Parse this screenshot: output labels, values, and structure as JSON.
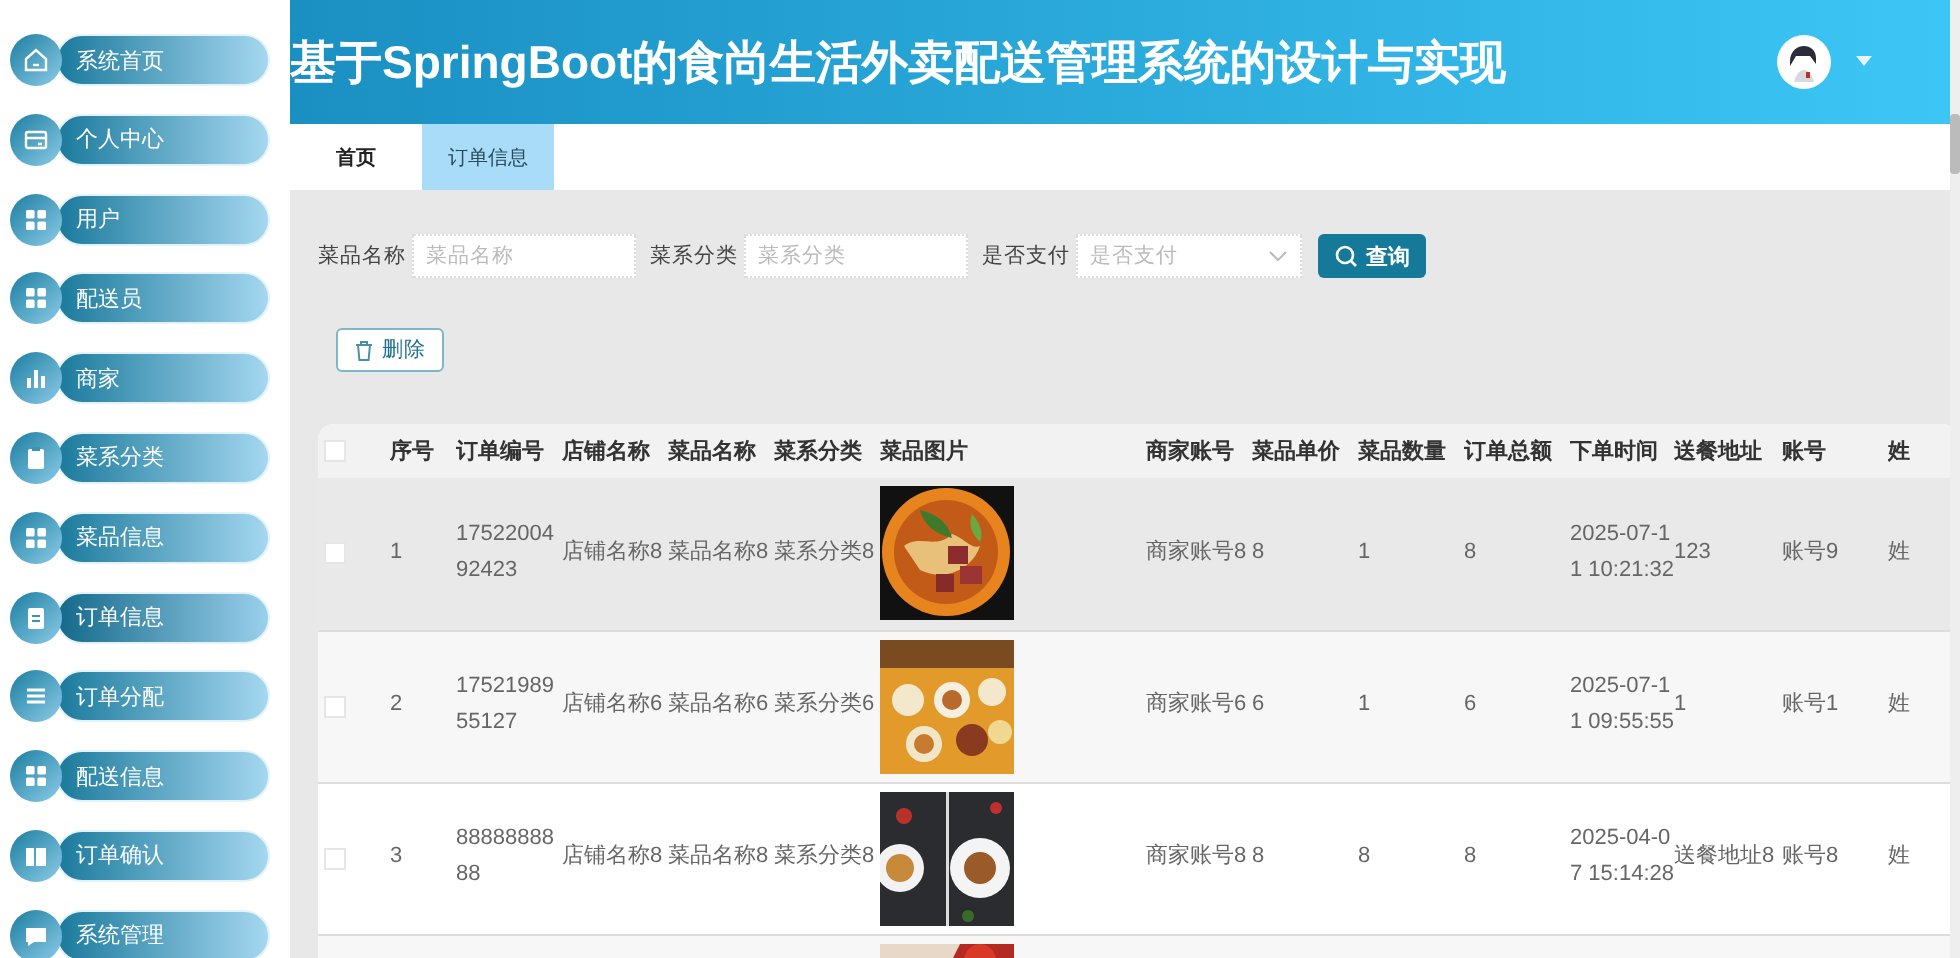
{
  "sidebar": {
    "items": [
      {
        "label": "系统首页",
        "selected": false
      },
      {
        "label": "个人中心",
        "selected": false
      },
      {
        "label": "用户",
        "selected": false
      },
      {
        "label": "配送员",
        "selected": false
      },
      {
        "label": "商家",
        "selected": false
      },
      {
        "label": "菜系分类",
        "selected": false
      },
      {
        "label": "菜品信息",
        "selected": false
      },
      {
        "label": "订单信息",
        "selected": true
      },
      {
        "label": "订单分配",
        "selected": false
      },
      {
        "label": "配送信息",
        "selected": false
      },
      {
        "label": "订单确认",
        "selected": false
      },
      {
        "label": "系统管理",
        "selected": false
      }
    ]
  },
  "header": {
    "title": "基于SpringBoot的食尚生活外卖配送管理系统的设计与实现"
  },
  "tabs": [
    {
      "label": "首页",
      "selected": false
    },
    {
      "label": "订单信息",
      "selected": true
    }
  ],
  "search": {
    "fields": [
      {
        "label": "菜品名称",
        "placeholder": "菜品名称",
        "kind": "input"
      },
      {
        "label": "菜系分类",
        "placeholder": "菜系分类",
        "kind": "input"
      },
      {
        "label": "是否支付",
        "placeholder": "是否支付",
        "kind": "select"
      }
    ],
    "button": "查询"
  },
  "delete_button": "删除",
  "table": {
    "all_checked": false,
    "columns": [
      "序号",
      "订单编号",
      "店铺名称",
      "菜品名称",
      "菜系分类",
      "菜品图片",
      "商家账号",
      "菜品单价",
      "菜品数量",
      "订单总额",
      "下单时间",
      "送餐地址",
      "账号",
      "姓"
    ],
    "rows": [
      {
        "checked": false,
        "hovered": true,
        "cells": [
          "1",
          "1752200492423",
          "店铺名称8",
          "菜品名称8",
          "菜系分类8",
          "",
          "商家账号8",
          "8",
          "1",
          "8",
          "2025-07-11 10:21:32",
          "123",
          "账号9",
          "姓"
        ]
      },
      {
        "checked": false,
        "hovered": false,
        "cells": [
          "2",
          "1752198955127",
          "店铺名称6",
          "菜品名称6",
          "菜系分类6",
          "",
          "商家账号6",
          "6",
          "1",
          "6",
          "2025-07-11 09:55:55",
          "1",
          "账号1",
          "姓"
        ]
      },
      {
        "checked": false,
        "hovered": false,
        "cells": [
          "3",
          "8888888888",
          "店铺名称8",
          "菜品名称8",
          "菜系分类8",
          "",
          "商家账号8",
          "8",
          "8",
          "8",
          "2025-04-07 15:14:28",
          "送餐地址8",
          "账号8",
          "姓"
        ]
      },
      {
        "cells": []
      }
    ]
  }
}
